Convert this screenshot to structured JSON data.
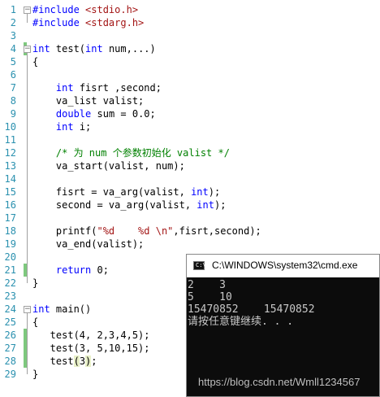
{
  "editor": {
    "lines": [
      {
        "n": "1",
        "html": "<span class='pp'>#include</span> <span class='str'>&lt;stdio.h&gt;</span>"
      },
      {
        "n": "2",
        "html": "<span class='pp'>#include</span> <span class='str'>&lt;stdarg.h&gt;</span>"
      },
      {
        "n": "3",
        "html": ""
      },
      {
        "n": "4",
        "html": "<span class='kw'>int</span> test(<span class='kw'>int</span> num,...)"
      },
      {
        "n": "5",
        "html": "{"
      },
      {
        "n": "6",
        "html": ""
      },
      {
        "n": "7",
        "html": "    <span class='kw'>int</span> fisrt ,second;"
      },
      {
        "n": "8",
        "html": "    va_list valist;"
      },
      {
        "n": "9",
        "html": "    <span class='kw'>double</span> sum = 0.0;"
      },
      {
        "n": "10",
        "html": "    <span class='kw'>int</span> i;"
      },
      {
        "n": "11",
        "html": ""
      },
      {
        "n": "12",
        "html": "    <span class='cm'>/* 为 num 个参数初始化 valist */</span>"
      },
      {
        "n": "13",
        "html": "    va_start(valist, num);"
      },
      {
        "n": "14",
        "html": ""
      },
      {
        "n": "15",
        "html": "    fisrt = va_arg(valist, <span class='kw'>int</span>);"
      },
      {
        "n": "16",
        "html": "    second = va_arg(valist, <span class='kw'>int</span>);"
      },
      {
        "n": "17",
        "html": ""
      },
      {
        "n": "18",
        "html": "    printf(<span class='str'>\"%d    %d \\n\"</span>,fisrt,second);"
      },
      {
        "n": "19",
        "html": "    va_end(valist);"
      },
      {
        "n": "20",
        "html": ""
      },
      {
        "n": "21",
        "html": "    <span class='kw'>return</span> 0;"
      },
      {
        "n": "22",
        "html": "}"
      },
      {
        "n": "23",
        "html": ""
      },
      {
        "n": "24",
        "html": "<span class='kw'>int</span> main()"
      },
      {
        "n": "25",
        "html": "{"
      },
      {
        "n": "26",
        "html": "   test(4, 2,3,4,5);"
      },
      {
        "n": "27",
        "html": "   test(3, 5,10,15);"
      },
      {
        "n": "28",
        "html": "   test<span class='hl'>(</span>3<span class='hl'>)</span>;"
      },
      {
        "n": "29",
        "html": "}"
      }
    ]
  },
  "console": {
    "title": "C:\\WINDOWS\\system32\\cmd.exe",
    "icon_name": "terminal-icon",
    "icon_glyph": "C:\\",
    "lines": [
      "2    3",
      "5    10",
      "15470852    15470852",
      "请按任意键继续. . ."
    ]
  },
  "watermark": "https://blog.csdn.net/Wmll1234567",
  "colors": {
    "keyword": "#0000ff",
    "string": "#a31515",
    "comment": "#008000",
    "line_number": "#2b91af",
    "change_marker": "#7ec87e",
    "console_bg": "#0c0c0c",
    "console_text": "#c8c8c8"
  }
}
